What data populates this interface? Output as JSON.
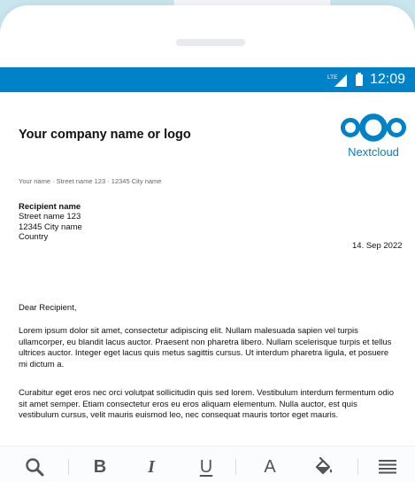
{
  "status_bar": {
    "network": "LTE",
    "time": "12:09"
  },
  "document": {
    "company": "Your company name or logo",
    "logo_text": "Nextcloud",
    "sender_line": "Your name · Street name 123 · 12345 City name",
    "recipient": {
      "name": "Recipient name",
      "street": "Street name 123",
      "city": "12345 City name",
      "country": "Country"
    },
    "date": "14. Sep 2022",
    "greeting": "Dear Recipient,",
    "paragraphs": [
      "Lorem ipsum dolor sit amet, consectetur adipiscing elit. Nullam malesuada sapien vel turpis ullamcorper, eu blandit lacus auctor. Praesent non pharetra libero. Nullam scelerisque turpis et tellus ultrices auctor. Integer eget lacus quis metus sagittis cursus. Ut interdum pharetra ligula, et posuere mi dictum a.",
      "Curabitur eget eros nec orci volutpat sollicitudin quis sed lorem. Vestibulum interdum fermentum odio sit amet semper. Etiam consectetur eros eu eros aliquam elementum. Nulla auctor, est quis vestibulum cursus, velit mauris euismod leo, nec consequat mauris tortor eget mauris."
    ]
  },
  "toolbar": {
    "bold": "B",
    "italic": "I",
    "underline": "U",
    "font_color": "A",
    "icons": [
      "search-icon",
      "fill-color-icon",
      "align-justify-icon"
    ]
  },
  "colors": {
    "brand": "#0082c9",
    "background": "#c9e6ef"
  }
}
